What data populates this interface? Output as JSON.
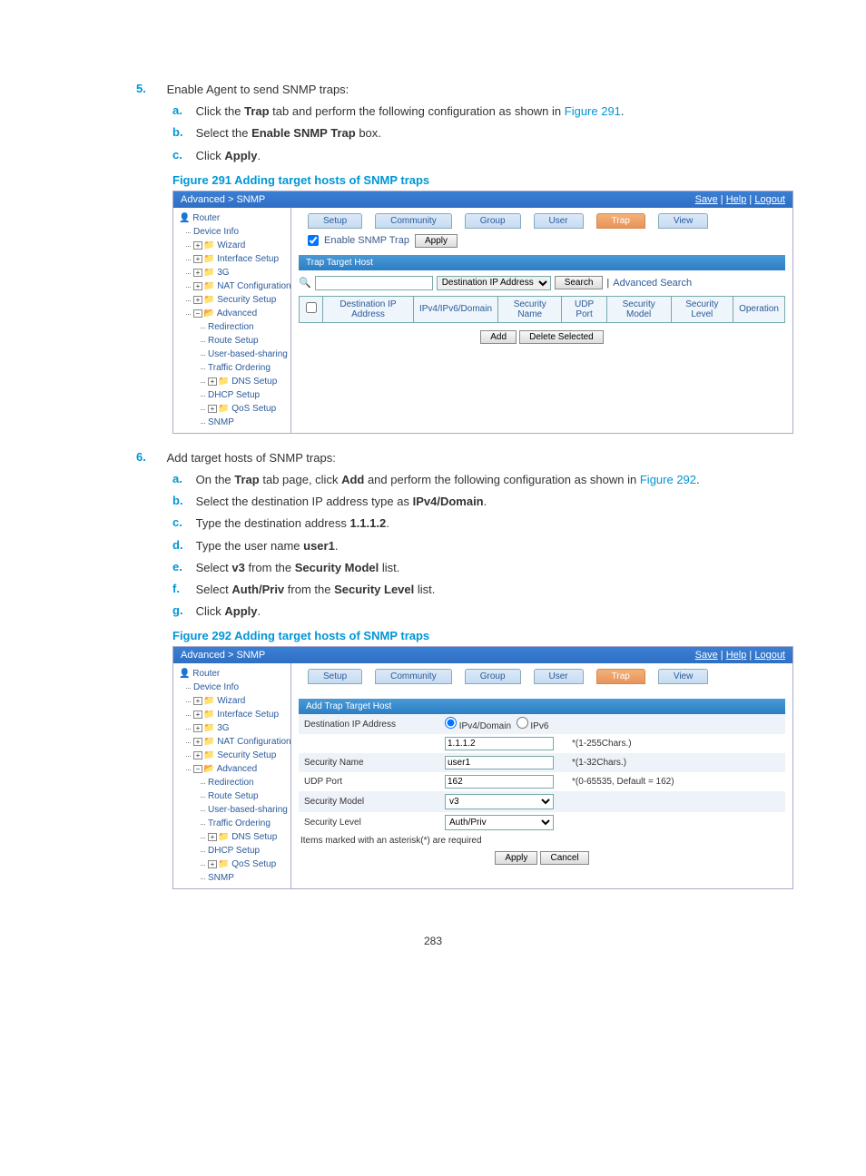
{
  "page_number": "283",
  "step5": {
    "num": "5.",
    "text": "Enable Agent to send SNMP traps:",
    "a_num": "a.",
    "a_text_pre": "Click the ",
    "a_bold": "Trap",
    "a_text_post": " tab and perform the following configuration as shown in ",
    "a_figref": "Figure 291",
    "a_period": ".",
    "b_num": "b.",
    "b_text_pre": "Select the ",
    "b_bold": "Enable SNMP Trap",
    "b_text_post": " box.",
    "c_num": "c.",
    "c_text_pre": "Click ",
    "c_bold": "Apply",
    "c_period": "."
  },
  "fig291_caption": "Figure 291 Adding target hosts of SNMP traps",
  "shot1": {
    "breadcrumb": "Advanced > SNMP",
    "save": "Save",
    "help": "Help",
    "logout": "Logout",
    "root": "Router",
    "nav": {
      "device_info": "Device Info",
      "wizard": "Wizard",
      "interface_setup": "Interface Setup",
      "g3": "3G",
      "nat_config": "NAT Configuration",
      "security_setup": "Security Setup",
      "advanced": "Advanced",
      "redirection": "Redirection",
      "route_setup": "Route Setup",
      "user_based": "User-based-sharing",
      "traffic": "Traffic Ordering",
      "dns": "DNS Setup",
      "dhcp": "DHCP Setup",
      "qos": "QoS Setup",
      "snmp": "SNMP"
    },
    "tabs": {
      "setup": "Setup",
      "community": "Community",
      "group": "Group",
      "user": "User",
      "trap": "Trap",
      "view": "View"
    },
    "enable_label": "Enable SNMP Trap",
    "apply_btn": "Apply",
    "section_title": "Trap Target Host",
    "search_select": "Destination IP Address",
    "search_btn": "Search",
    "adv_search": "Advanced Search",
    "table_headers": {
      "dest_ip": "Destination IP Address",
      "ipv4": "IPv4/IPv6/Domain",
      "sec_name": "Security Name",
      "udp": "UDP Port",
      "sec_model": "Security Model",
      "sec_level": "Security Level",
      "op": "Operation"
    },
    "add_btn": "Add",
    "del_btn": "Delete Selected"
  },
  "step6": {
    "num": "6.",
    "text": "Add target hosts of SNMP traps:",
    "a_num": "a.",
    "a_pre": "On the ",
    "a_b1": "Trap",
    "a_mid": " tab page, click ",
    "a_b2": "Add",
    "a_post": " and perform the following configuration as shown in ",
    "a_figref": "Figure 292",
    "a_period": ".",
    "b_num": "b.",
    "b_pre": "Select the destination IP address type as ",
    "b_bold": "IPv4/Domain",
    "b_period": ".",
    "c_num": "c.",
    "c_pre": "Type the destination address ",
    "c_bold": "1.1.1.2",
    "c_period": ".",
    "d_num": "d.",
    "d_pre": "Type the user name ",
    "d_bold": "user1",
    "d_period": ".",
    "e_num": "e.",
    "e_pre": "Select ",
    "e_bold": "v3",
    "e_mid": " from the ",
    "e_bold2": "Security Model",
    "e_post": " list.",
    "f_num": "f.",
    "f_pre": "Select ",
    "f_bold": "Auth/Priv",
    "f_mid": " from the ",
    "f_bold2": "Security Level",
    "f_post": " list.",
    "g_num": "g.",
    "g_pre": "Click ",
    "g_bold": "Apply",
    "g_period": "."
  },
  "fig292_caption": "Figure 292 Adding target hosts of SNMP traps",
  "shot2": {
    "breadcrumb": "Advanced > SNMP",
    "save": "Save",
    "help": "Help",
    "logout": "Logout",
    "root": "Router",
    "section_title": "Add Trap Target Host",
    "fields": {
      "dest_ip": "Destination IP Address",
      "ipv4_radio": "IPv4/Domain",
      "ipv6_radio": "IPv6",
      "addr_val": "1.1.1.2",
      "addr_hint": "*(1-255Chars.)",
      "sec_name": "Security Name",
      "sec_name_val": "user1",
      "sec_name_hint": "*(1-32Chars.)",
      "udp_port": "UDP Port",
      "udp_val": "162",
      "udp_hint": "*(0-65535, Default = 162)",
      "sec_model": "Security Model",
      "sec_model_val": "v3",
      "sec_level": "Security Level",
      "sec_level_val": "Auth/Priv"
    },
    "note": "Items marked with an asterisk(*) are required",
    "apply_btn": "Apply",
    "cancel_btn": "Cancel"
  }
}
